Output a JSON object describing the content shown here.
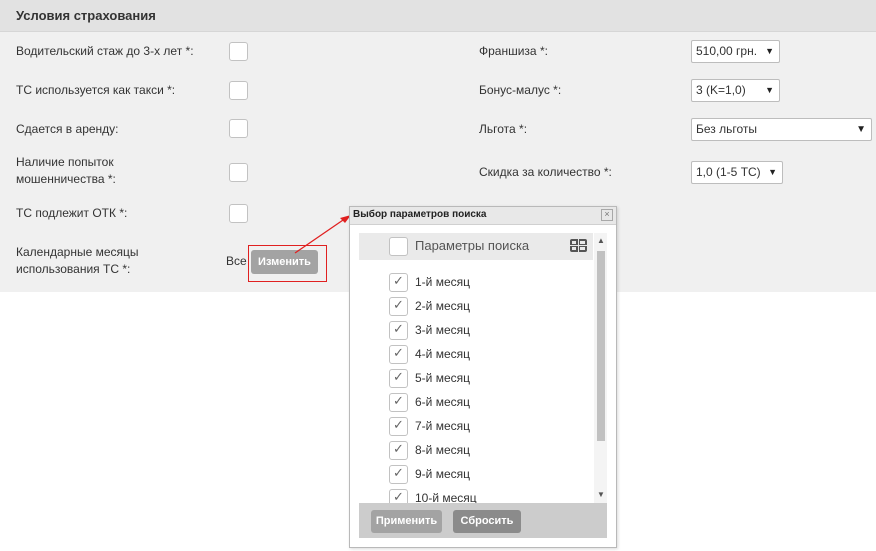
{
  "section": {
    "title": "Условия страхования"
  },
  "left_fields": [
    {
      "label": "Водительский стаж до 3-х лет *:"
    },
    {
      "label": "ТС используется как такси *:"
    },
    {
      "label": "Сдается в аренду:"
    },
    {
      "label_line1": "Наличие попыток",
      "label_line2": "мошенничества *:"
    },
    {
      "label": "ТС подлежит ОТК *:"
    },
    {
      "label_line1": "Календарные месяцы",
      "label_line2": "использования ТС *:",
      "value": "Все",
      "button": "Изменить"
    }
  ],
  "right_fields": [
    {
      "label": "Франшиза *:",
      "value": "510,00 грн."
    },
    {
      "label": "Бонус-малус *:",
      "value": "3 (K=1,0)"
    },
    {
      "label": "Льгота *:",
      "value": "Без льготы"
    },
    {
      "label": "Скидка за количество *:",
      "value": "1,0 (1-5 ТС)"
    }
  ],
  "dialog": {
    "title": "Выбор параметров поиска",
    "close": "×",
    "header_label": "Параметры поиска",
    "items": [
      "1-й месяц",
      "2-й месяц",
      "3-й месяц",
      "4-й месяц",
      "5-й месяц",
      "6-й месяц",
      "7-й месяц",
      "8-й месяц",
      "9-й месяц",
      "10-й месяц"
    ],
    "check_glyph": "✓",
    "apply": "Применить",
    "reset": "Сбросить"
  },
  "colors": {
    "highlight": "#e02020",
    "panel_bg": "#f0f0f0",
    "button_gray": "#a3a3a3"
  },
  "icons": {
    "dropdown": "triangle-down-icon",
    "grid": "grid-icon",
    "checkmark": "check-icon"
  }
}
